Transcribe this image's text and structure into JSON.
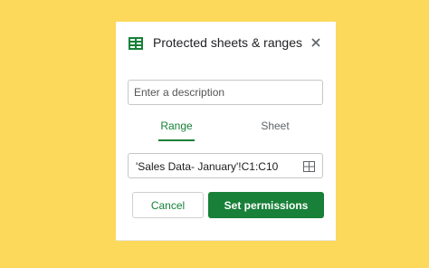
{
  "dialog": {
    "title": "Protected sheets & ranges",
    "close_icon": "close-icon",
    "sheets_icon": "google-sheets-icon"
  },
  "description": {
    "placeholder": "Enter a description",
    "value": ""
  },
  "tabs": [
    {
      "label": "Range",
      "active": true
    },
    {
      "label": "Sheet",
      "active": false
    }
  ],
  "range": {
    "value": "'Sales Data- January'!C1:C10",
    "select_icon": "grid-select-icon"
  },
  "buttons": {
    "cancel": "Cancel",
    "set_permissions": "Set permissions"
  },
  "colors": {
    "background": "#fcd95b",
    "accent_green": "#188038"
  }
}
